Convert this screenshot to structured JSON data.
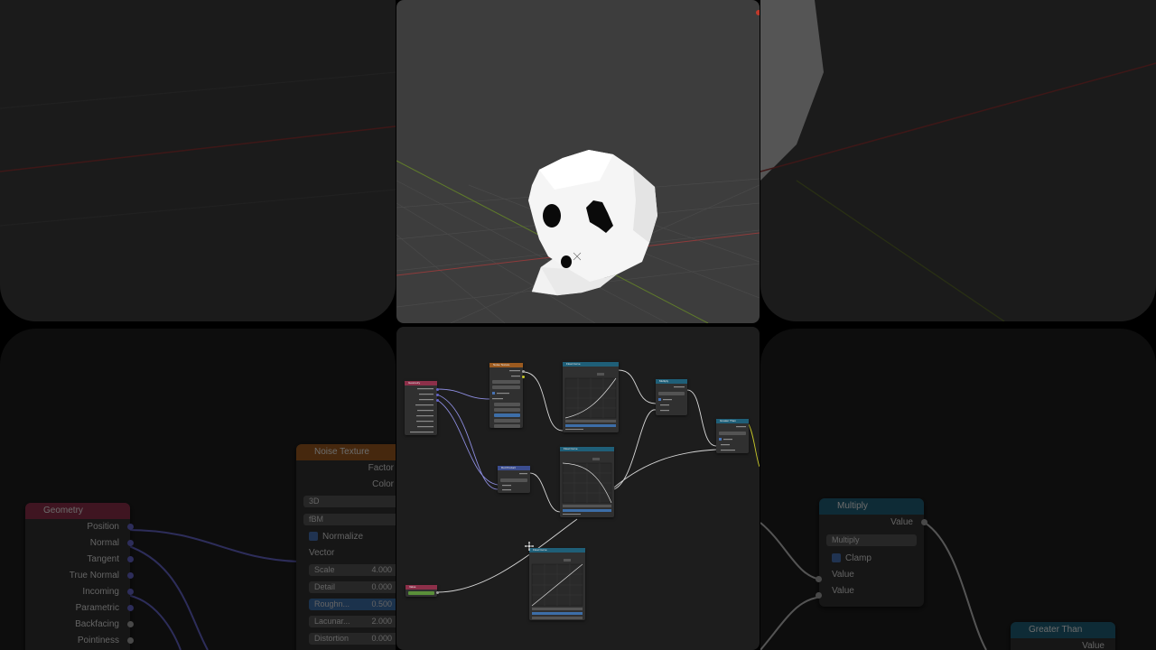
{
  "colors": {
    "geometry_header": "#8c2f49",
    "texture_header": "#9b5a1f",
    "vector_header": "#3b4d8f",
    "converter_header": "#1f5f78",
    "input_header": "#8c2f49",
    "value_green": "#5a8f3a",
    "field_blue": "#3d6ea8",
    "socket_vector": "#6363c7",
    "socket_float": "#a1a1a1",
    "socket_color": "#c7c729"
  },
  "left_geometry": {
    "title": "Geometry",
    "outputs": [
      "Position",
      "Normal",
      "Tangent",
      "True Normal",
      "Incoming",
      "Parametric",
      "Backfacing",
      "Pointiness"
    ]
  },
  "left_noise": {
    "title": "Noise Texture",
    "outputs": [
      "Factor",
      "Color"
    ],
    "dimensions": "3D",
    "type": "fBM",
    "normalize_label": "Normalize",
    "vector_label": "Vector",
    "fields": [
      {
        "label": "Scale",
        "value": "4.000"
      },
      {
        "label": "Detail",
        "value": "0.000"
      },
      {
        "label": "Roughn...",
        "value": "0.500"
      },
      {
        "label": "Lacunar...",
        "value": "2.000"
      },
      {
        "label": "Distortion",
        "value": "0.000"
      }
    ]
  },
  "right_multiply": {
    "title": "Multiply",
    "output": "Value",
    "operation": "Multiply",
    "clamp_label": "Clamp",
    "inputs": [
      "Value",
      "Value"
    ]
  },
  "right_greater": {
    "title": "Greater Than",
    "output": "Value"
  },
  "mini": {
    "geometry_title": "Geometry",
    "noise_title": "Noise Texture",
    "float_curve_title": "Float Curve",
    "multiply_title": "Multiply",
    "greater_title": "Greater Than",
    "dot_title": "Dot Product",
    "value_title": "Value"
  }
}
